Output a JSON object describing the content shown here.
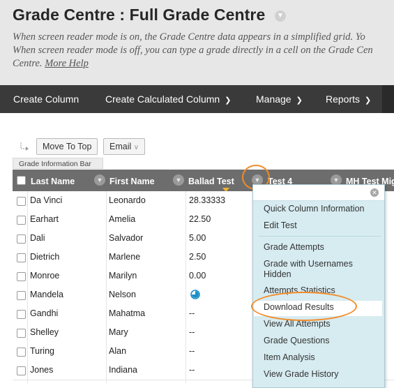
{
  "page": {
    "title": "Grade Centre : Full Grade Centre",
    "description_lines": [
      "When screen reader mode is on, the Grade Centre data appears in a simplified grid. Yo",
      "When screen reader mode is off, you can type a grade directly in a cell on the Grade Cen",
      "Centre."
    ],
    "more_help": "More Help"
  },
  "toolbar": {
    "create_column": "Create Column",
    "create_calculated_column": "Create Calculated Column",
    "manage": "Manage",
    "reports": "Reports"
  },
  "actions": {
    "move_to_top": "Move To Top",
    "email": "Email",
    "grade_information_bar": "Grade Information Bar"
  },
  "grid": {
    "columns": [
      "Last Name",
      "First Name",
      "Ballad Test",
      "Test 4",
      "MH Test Mig"
    ],
    "rows": [
      {
        "last": "Da Vinci",
        "first": "Leonardo",
        "ballad": "28.33333"
      },
      {
        "last": "Earhart",
        "first": "Amelia",
        "ballad": "22.50"
      },
      {
        "last": "Dali",
        "first": "Salvador",
        "ballad": "5.00"
      },
      {
        "last": "Dietrich",
        "first": "Marlene",
        "ballad": "2.50"
      },
      {
        "last": "Monroe",
        "first": "Marilyn",
        "ballad": "0.00"
      },
      {
        "last": "Mandela",
        "first": "Nelson",
        "ballad": "",
        "in_progress": true
      },
      {
        "last": "Gandhi",
        "first": "Mahatma",
        "ballad": "--"
      },
      {
        "last": "Shelley",
        "first": "Mary",
        "ballad": "--"
      },
      {
        "last": "Turing",
        "first": "Alan",
        "ballad": "--"
      },
      {
        "last": "Jones",
        "first": "Indiana",
        "ballad": "--"
      }
    ]
  },
  "menu": {
    "items": [
      "Quick Column Information",
      "Edit Test",
      "Grade Attempts",
      "Grade with Usernames Hidden",
      "Attempts Statistics",
      "Download Results",
      "View All Attempts",
      "Grade Questions",
      "Item Analysis",
      "View Grade History"
    ],
    "highlighted": "Download Results"
  },
  "colors": {
    "toolbar_bg": "#3a3a3a",
    "grid_header_bg": "#6d6d6d",
    "menu_bg": "#d7ecf1",
    "annotation_ring": "#f28c28"
  }
}
